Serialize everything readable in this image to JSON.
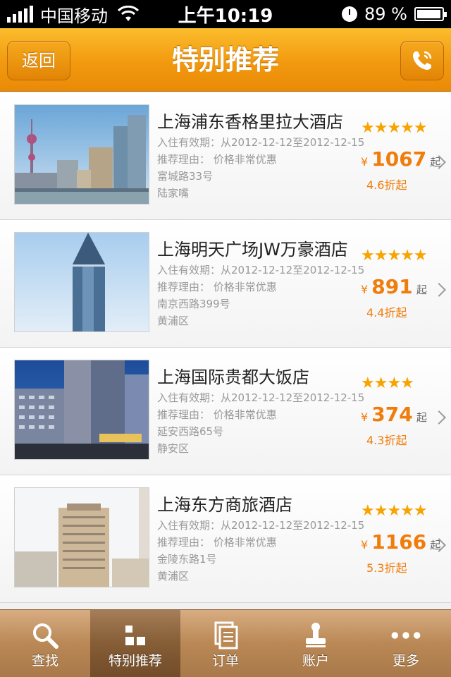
{
  "status_bar": {
    "carrier": "中国移动",
    "time": "上午10:19",
    "battery": "89 %",
    "icons": [
      "signal-icon",
      "wifi-icon",
      "alarm-icon",
      "battery-icon"
    ]
  },
  "nav": {
    "title": "特别推荐",
    "back_label": "返回",
    "phone_icon": "phone-icon"
  },
  "hotels": [
    {
      "name": "上海浦东香格里拉大酒店",
      "validity": "入住有效期：从2012-12-12至2012-12-15",
      "reason": "推荐理由：  价格非常优惠",
      "address": "富城路33号",
      "district": "陆家嘴",
      "stars": "★★★★★",
      "currency": "¥",
      "price": "1067",
      "price_suffix": "起",
      "discount": "4.6折起"
    },
    {
      "name": "上海明天广场JW万豪酒店",
      "validity": "入住有效期：从2012-12-12至2012-12-15",
      "reason": "推荐理由：  价格非常优惠",
      "address": "南京西路399号",
      "district": "黄浦区",
      "stars": "★★★★★",
      "currency": "¥",
      "price": "891",
      "price_suffix": "起",
      "discount": "4.4折起"
    },
    {
      "name": "上海国际贵都大饭店",
      "validity": "入住有效期：从2012-12-12至2012-12-15",
      "reason": "推荐理由：  价格非常优惠",
      "address": "延安西路65号",
      "district": "静安区",
      "stars": "★★★★",
      "currency": "¥",
      "price": "374",
      "price_suffix": "起",
      "discount": "4.3折起"
    },
    {
      "name": "上海东方商旅酒店",
      "validity": "入住有效期：从2012-12-12至2012-12-15",
      "reason": "推荐理由：  价格非常优惠",
      "address": "金陵东路1号",
      "district": "黄浦区",
      "stars": "★★★★★",
      "currency": "¥",
      "price": "1166",
      "price_suffix": "起",
      "discount": "5.3折起"
    }
  ],
  "tabs": [
    {
      "label": "查找",
      "icon": "search-icon",
      "active": false
    },
    {
      "label": "特别推荐",
      "icon": "grid-icon",
      "active": true
    },
    {
      "label": "订单",
      "icon": "document-icon",
      "active": false
    },
    {
      "label": "账户",
      "icon": "stamp-icon",
      "active": false
    },
    {
      "label": "更多",
      "icon": "more-icon",
      "active": false
    }
  ],
  "colors": {
    "nav_orange": "#f2990f",
    "price_orange": "#f07c0a",
    "star_gold": "#f7a300",
    "tab_brown": "#b98855"
  }
}
